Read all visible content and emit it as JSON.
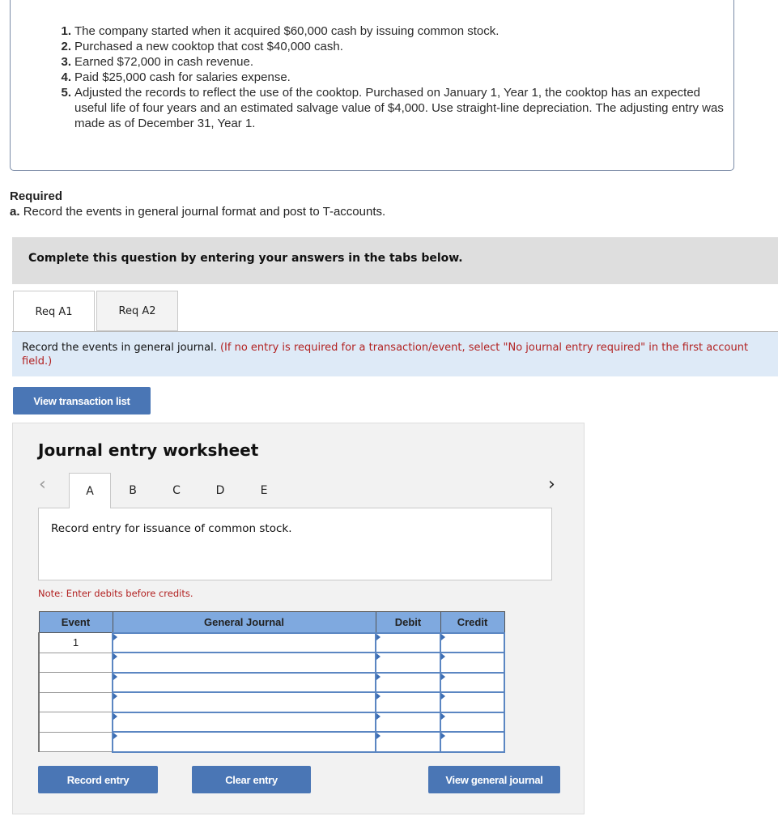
{
  "problem": {
    "items": [
      {
        "num": "1.",
        "text": "The company started when it acquired $60,000 cash by issuing common stock."
      },
      {
        "num": "2.",
        "text": "Purchased a new cooktop that cost $40,000 cash."
      },
      {
        "num": "3.",
        "text": "Earned $72,000 in cash revenue."
      },
      {
        "num": "4.",
        "text": "Paid $25,000 cash for salaries expense."
      },
      {
        "num": "5.",
        "text": "Adjusted the records to reflect the use of the cooktop. Purchased on January 1, Year 1, the cooktop has an expected useful life of four years and an estimated salvage value of $4,000. Use straight-line depreciation. The adjusting entry was made as of December 31, Year 1."
      }
    ]
  },
  "required": {
    "title": "Required",
    "part_label": "a.",
    "part_text": "Record the events in general journal format and post to T-accounts."
  },
  "instruction": "Complete this question by entering your answers in the tabs below.",
  "req_tabs": [
    {
      "label": "Req A1",
      "active": true
    },
    {
      "label": "Req A2",
      "active": false
    }
  ],
  "info": {
    "main": "Record the events in general journal.",
    "note": "(If no entry is required for a transaction/event, select \"No journal entry required\" in the first account field.)"
  },
  "buttons": {
    "view_transaction_list": "View transaction list",
    "record_entry": "Record entry",
    "clear_entry": "Clear entry",
    "view_general_journal": "View general journal"
  },
  "worksheet": {
    "title": "Journal entry worksheet",
    "prev_icon": "‹",
    "next_icon": "›",
    "tabs": [
      {
        "label": "A",
        "active": true
      },
      {
        "label": "B",
        "active": false
      },
      {
        "label": "C",
        "active": false
      },
      {
        "label": "D",
        "active": false
      },
      {
        "label": "E",
        "active": false
      }
    ],
    "description": "Record entry for issuance of common stock.",
    "note": "Note: Enter debits before credits."
  },
  "journal": {
    "headers": {
      "event": "Event",
      "general_journal": "General Journal",
      "debit": "Debit",
      "credit": "Credit"
    },
    "rows": [
      {
        "event": "1",
        "account": "",
        "debit": "",
        "credit": ""
      },
      {
        "event": "",
        "account": "",
        "debit": "",
        "credit": ""
      },
      {
        "event": "",
        "account": "",
        "debit": "",
        "credit": ""
      },
      {
        "event": "",
        "account": "",
        "debit": "",
        "credit": ""
      },
      {
        "event": "",
        "account": "",
        "debit": "",
        "credit": ""
      },
      {
        "event": "",
        "account": "",
        "debit": "",
        "credit": ""
      }
    ]
  }
}
